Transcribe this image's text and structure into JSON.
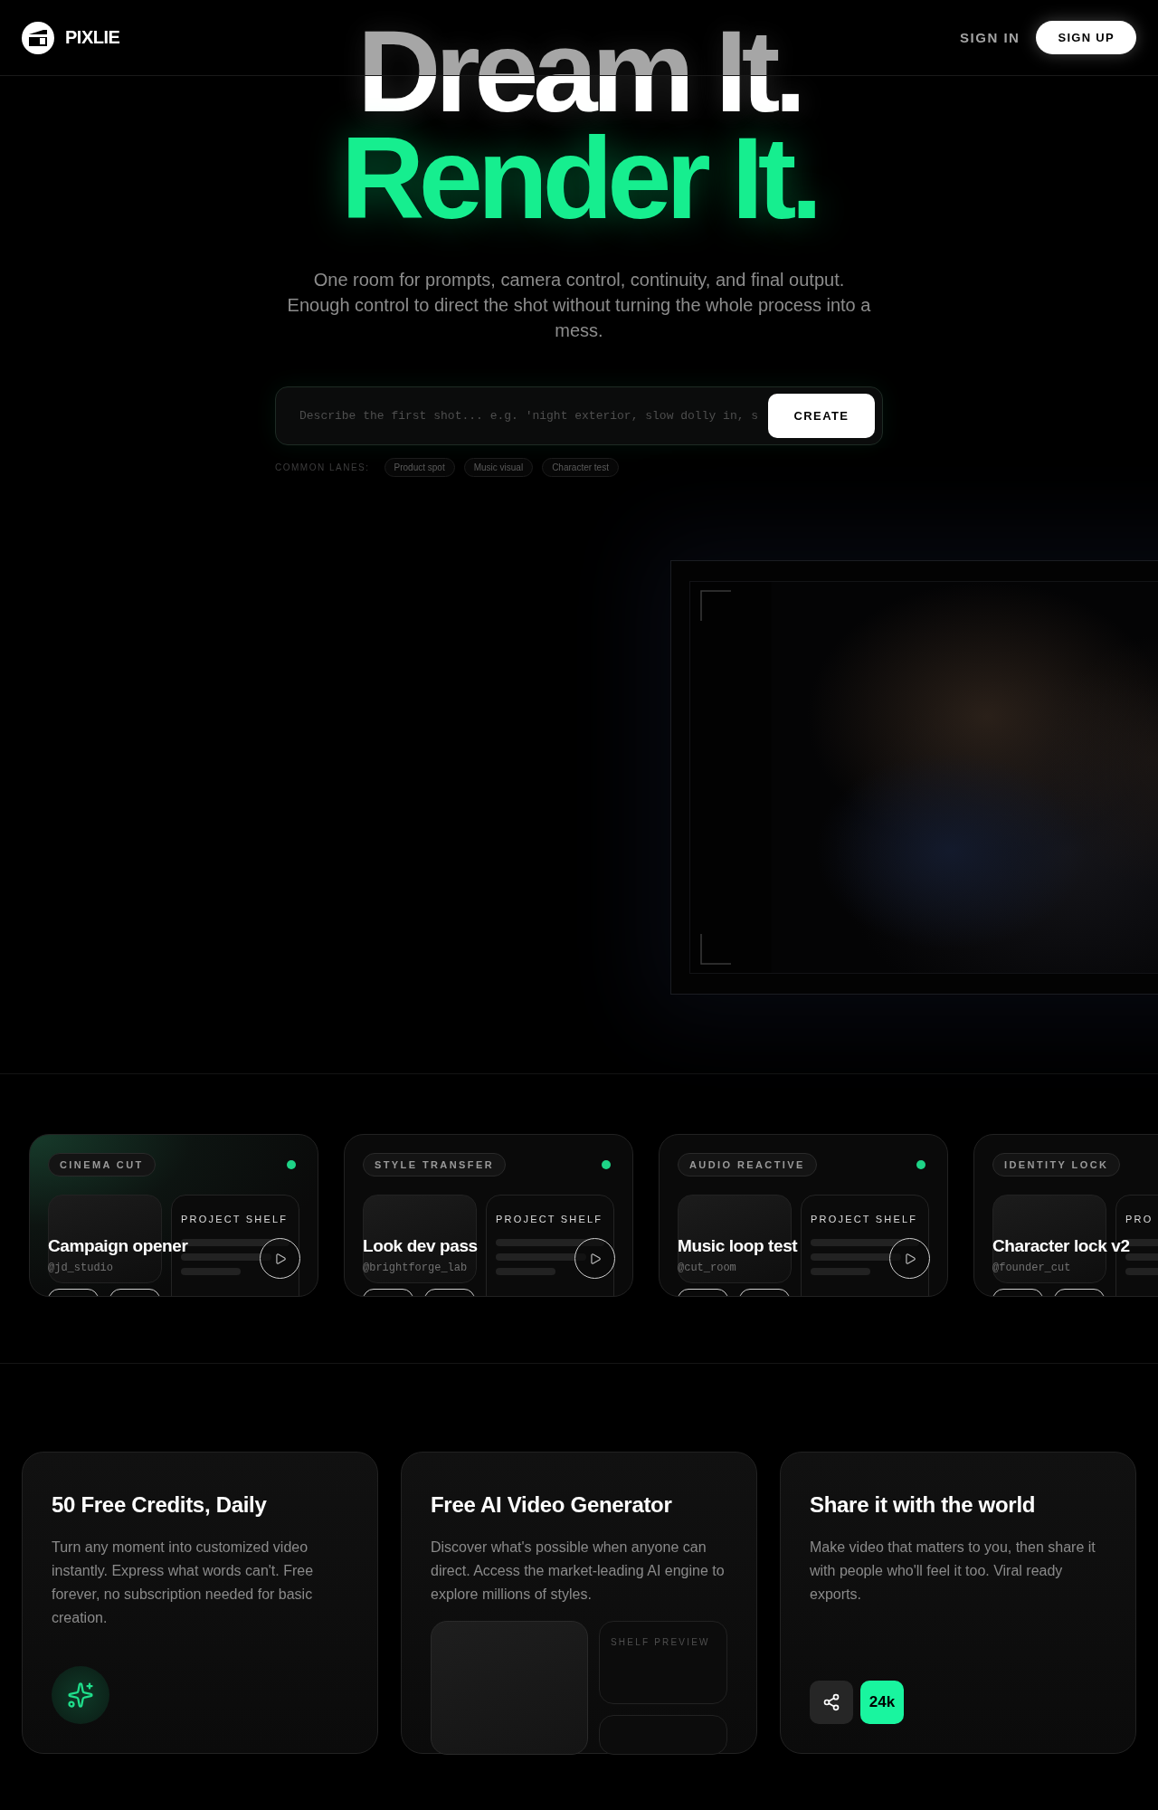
{
  "header": {
    "brand": "PIXLIE",
    "sign_in": "SIGN IN",
    "sign_up": "SIGN UP"
  },
  "hero": {
    "headline_1": "Dream It.",
    "headline_2": "Render It.",
    "subtitle": "One room for prompts, camera control, continuity, and final output. Enough control to direct the shot without turning the whole process into a mess.",
    "prompt": {
      "placeholder": "Describe the first shot... e.g. 'night exterior, slow dolly in, s",
      "button": "CREATE"
    },
    "lanes_label": "COMMON LANES:",
    "lanes": [
      "Product spot",
      "Music visual",
      "Character test"
    ]
  },
  "projects": [
    {
      "kind": "full",
      "tag": "CINEMA CUT",
      "shelf": "PROJECT SHELF",
      "title": "Campaign opener",
      "handle": "@jd_studio",
      "selected": true
    },
    {
      "kind": "full",
      "tag": "STYLE TRANSFER",
      "shelf": "PROJECT SHELF",
      "title": "Look dev pass",
      "handle": "@brightforge_lab",
      "selected": false
    },
    {
      "kind": "full",
      "tag": "AUDIO REACTIVE",
      "shelf": "PROJECT SHELF",
      "title": "Music loop test",
      "handle": "@cut_room",
      "selected": false
    },
    {
      "kind": "clipped",
      "tag": "IDENTITY LOCK",
      "shelf": "PRO",
      "title": "Character lock v2",
      "handle": "@founder_cut",
      "selected": false
    }
  ],
  "features": [
    {
      "kind": "credits",
      "title": "50 Free Credits, Daily",
      "body": "Turn any moment into customized video instantly. Express what words can't. Free forever, no subscription needed for basic creation."
    },
    {
      "kind": "generator",
      "title": "Free AI Video Generator",
      "body": "Discover what's possible when anyone can direct. Access the market-leading AI engine to explore millions of styles.",
      "shelf_label": "SHELF PREVIEW"
    },
    {
      "kind": "share",
      "title": "Share it with the world",
      "body": "Make video that matters to you, then share it with people who'll feel it too. Viral ready exports.",
      "count": "24k"
    }
  ]
}
